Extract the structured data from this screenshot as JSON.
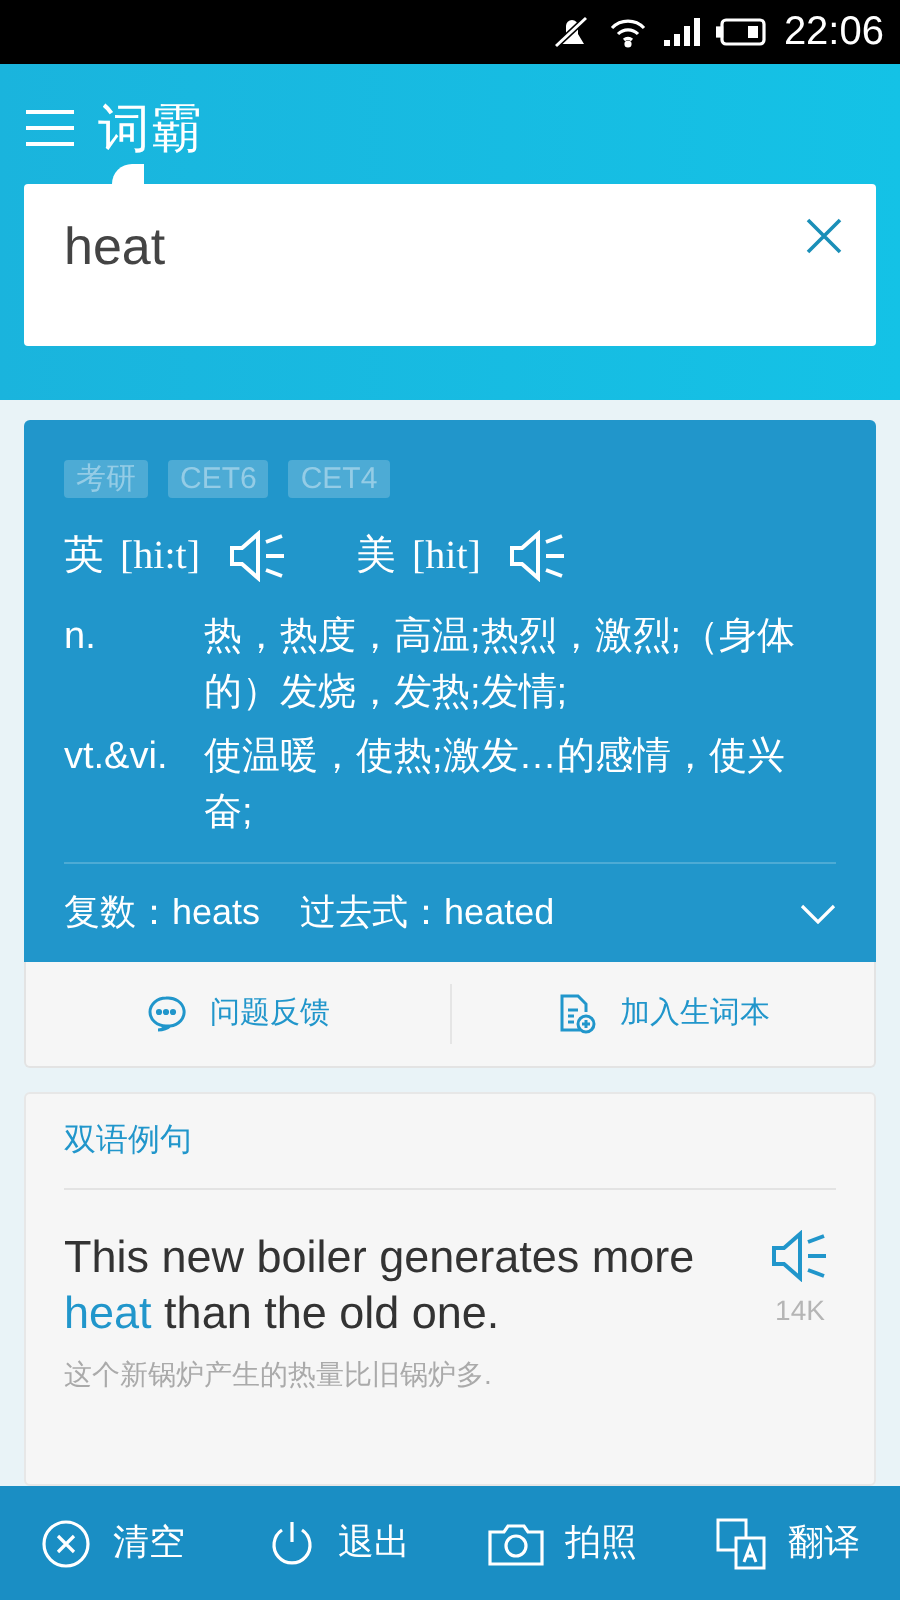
{
  "status_bar": {
    "time": "22:06"
  },
  "app": {
    "title": "词霸"
  },
  "search": {
    "value": "heat"
  },
  "entry": {
    "tags": [
      "考研",
      "CET6",
      "CET4"
    ],
    "pronunciations": [
      {
        "label": "英",
        "phonetic": "[hi:t]"
      },
      {
        "label": "美",
        "phonetic": "[hit]"
      }
    ],
    "definitions": [
      {
        "pos": "n.",
        "meaning": "热，热度，高温;热烈，激烈;（身体的）发烧，发热;发情;"
      },
      {
        "pos": "vt.&vi.",
        "meaning": "使温暖，使热;激发…的感情，使兴奋;"
      }
    ],
    "forms": [
      {
        "label": "复数：",
        "value": "heats"
      },
      {
        "label": "过去式：",
        "value": "heated"
      }
    ],
    "expanded": false
  },
  "actions": [
    {
      "kind": "feedback",
      "label": "问题反馈"
    },
    {
      "kind": "add",
      "label": "加入生词本"
    }
  ],
  "examples": {
    "title": "双语例句",
    "items": [
      {
        "sentence": [
          {
            "text": "This new boiler generates more ",
            "highlight": false
          },
          {
            "text": "heat",
            "highlight": true
          },
          {
            "text": " than the old one.",
            "highlight": false
          }
        ],
        "translation": "这个新锅炉产生的热量比旧锅炉多.",
        "count": "14K"
      }
    ]
  },
  "toolbar": [
    {
      "kind": "clear",
      "label": "清空"
    },
    {
      "kind": "exit",
      "label": "退出"
    },
    {
      "kind": "camera",
      "label": "拍照"
    },
    {
      "kind": "translate",
      "label": "翻译"
    }
  ]
}
